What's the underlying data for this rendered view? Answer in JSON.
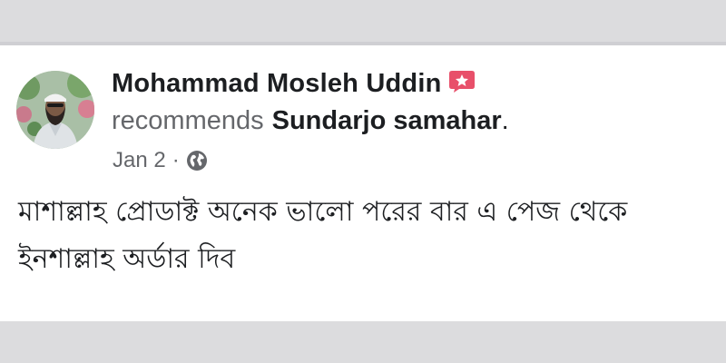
{
  "post": {
    "author_name": "Mohammad Mosleh Uddin",
    "recommends_verb": "recommends",
    "page_name": "Sundarjo samahar",
    "period": ".",
    "date": "Jan 2",
    "separator": "·",
    "privacy_icon": "globe-icon",
    "badge_icon": "recommendation-badge-icon",
    "review_lines": [
      "মাশাল্লাহ প্রোডাক্ট অনেক ভালো পরের বার এ পেজ থেকে",
      "ইনশাল্লাহ অর্ডার দিব"
    ]
  },
  "colors": {
    "badge": "#e8506a",
    "secondary_text": "#65676b",
    "primary_text": "#1c1e21",
    "background": "#dcdcde",
    "card": "#ffffff"
  }
}
